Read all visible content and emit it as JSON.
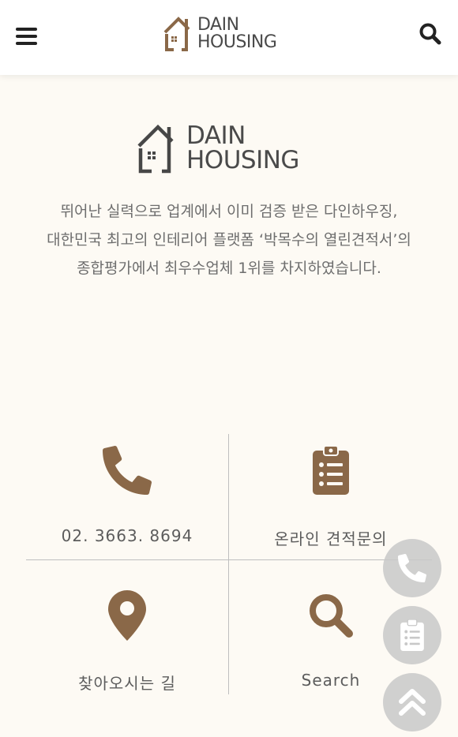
{
  "header": {
    "logo_line1": "DAIN",
    "logo_line2": "HOUSING",
    "menu_icon": "hamburger-menu-icon",
    "search_icon": "search-icon"
  },
  "hero": {
    "logo_line1": "DAIN",
    "logo_line2": "HOUSING",
    "intro_lines": [
      "뛰어난 실력으로 업계에서 이미 검증 받은 다인하우징,",
      "대한민국 최고의 인테리어 플랫폼 ‘박목수의 열린견적서’의",
      "종합평가에서 최우수업체 1위를 차지하였습니다."
    ]
  },
  "quick_links": [
    {
      "label": "02. 3663. 8694",
      "icon": "phone-icon"
    },
    {
      "label": "온라인 견적문의",
      "icon": "clipboard-list-icon"
    },
    {
      "label": "찾아오시는 길",
      "icon": "map-marker-icon"
    },
    {
      "label": "Search",
      "icon": "search-icon"
    }
  ],
  "floating_buttons": [
    {
      "icon": "phone-icon"
    },
    {
      "icon": "clipboard-list-icon"
    },
    {
      "icon": "double-chevron-up-icon"
    }
  ],
  "colors": {
    "brand_brown": "#8a6848",
    "page_bg": "#fdfaf4",
    "header_bg": "#ffffff",
    "text_gray": "#6e6e6e",
    "fab_gray": "#c8c8c8"
  }
}
